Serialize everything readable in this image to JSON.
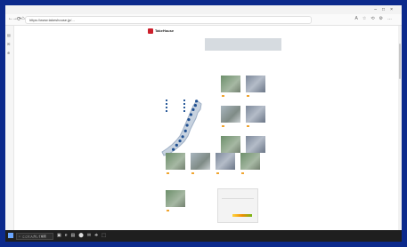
{
  "browser": {
    "title": "",
    "url": "https://www.takeshouse.jp/...",
    "window_controls": [
      "–",
      "□",
      "×"
    ],
    "nav": [
      "←",
      "→",
      "⟳",
      "⌂"
    ],
    "tool_icons": [
      "A",
      "☆",
      "⟲",
      "⚙",
      "…"
    ],
    "sidebar_icons": [
      "▤",
      "✉",
      "⊕"
    ]
  },
  "site": {
    "logo_text": "TakeHouse",
    "global_nav": [
      "",
      "",
      "",
      "",
      "",
      "",
      ""
    ],
    "section_title": "",
    "section_desc": ""
  },
  "map": {
    "legend_title": "",
    "legend_items": [
      "",
      "",
      "",
      "",
      "",
      "",
      "",
      ""
    ],
    "points": [
      [
        0.72,
        0.06
      ],
      [
        0.7,
        0.12
      ],
      [
        0.66,
        0.18
      ],
      [
        0.62,
        0.25
      ],
      [
        0.58,
        0.32
      ],
      [
        0.55,
        0.4
      ],
      [
        0.52,
        0.48
      ],
      [
        0.47,
        0.56
      ],
      [
        0.42,
        0.62
      ],
      [
        0.36,
        0.68
      ],
      [
        0.3,
        0.74
      ]
    ]
  },
  "projects": [
    {
      "title": "",
      "sub": ""
    },
    {
      "title": "",
      "sub": ""
    },
    {
      "title": "",
      "sub": ""
    },
    {
      "title": "",
      "sub": ""
    },
    {
      "title": "",
      "sub": ""
    },
    {
      "title": "",
      "sub": ""
    },
    {
      "title": "",
      "sub": ""
    },
    {
      "title": "",
      "sub": ""
    },
    {
      "title": "",
      "sub": ""
    },
    {
      "title": "",
      "sub": ""
    },
    {
      "title": "",
      "sub": ""
    }
  ],
  "infobox": {
    "title": "",
    "lines": [
      "",
      ""
    ]
  },
  "taskbar": {
    "search_placeholder": "ここに入力して検索",
    "app_icons": [
      "▣",
      "e",
      "▤",
      "⬤",
      "✉",
      "⎈",
      "⬚"
    ],
    "tray_text": "",
    "clock": ""
  }
}
